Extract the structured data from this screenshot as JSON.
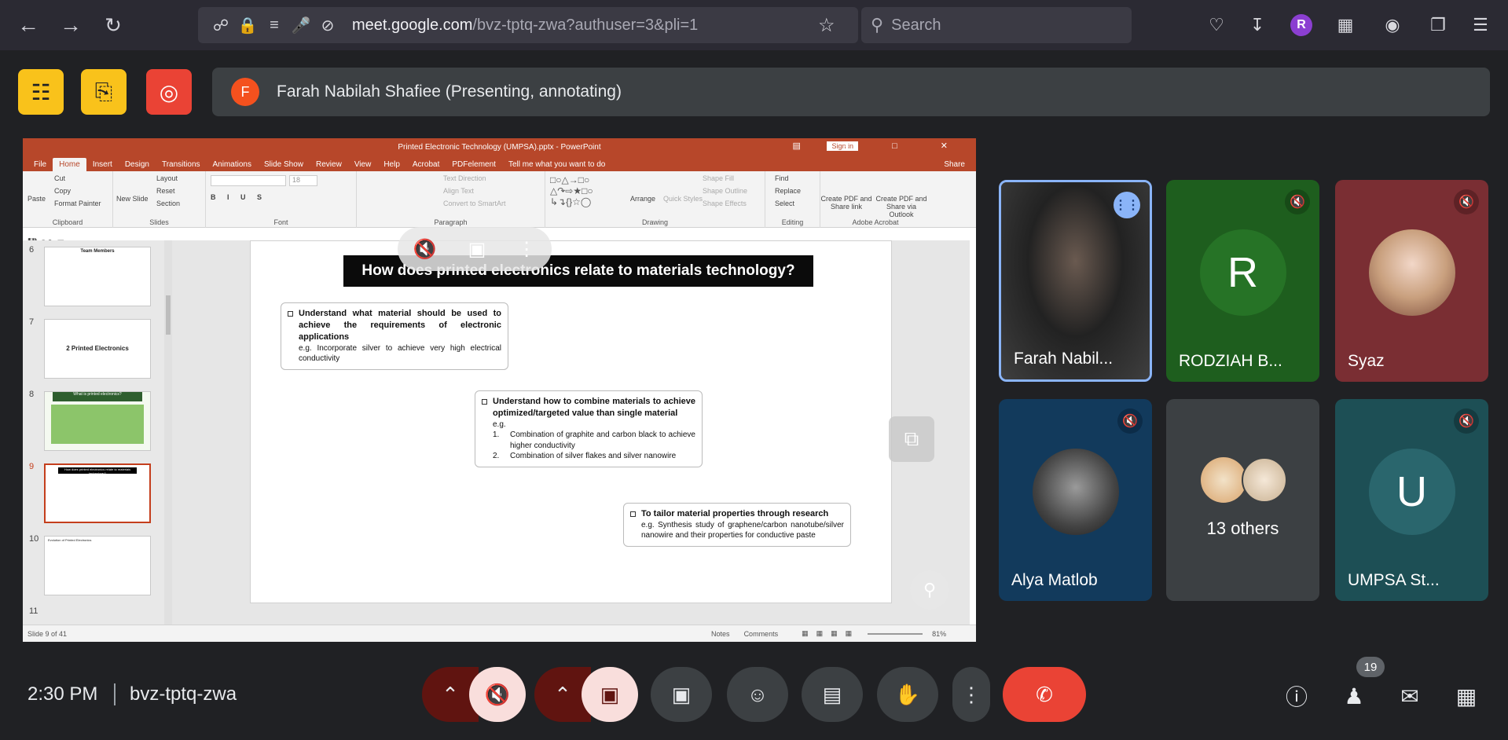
{
  "browser": {
    "url_domain": "meet.google.com",
    "url_path": "/bvz-tptq-zwa?authuser=3&pli=1",
    "search_placeholder": "Search",
    "profile_initial": "R"
  },
  "meet": {
    "presenter_initial": "F",
    "presenter_text": "Farah Nabilah Shafiee (Presenting, annotating)",
    "time": "2:30 PM",
    "meeting_code": "bvz-tptq-zwa",
    "people_count": "19"
  },
  "ppt": {
    "window_title": "Printed Electronic Technology (UMPSA).pptx - PowerPoint",
    "sign_in": "Sign in",
    "tabs": [
      "File",
      "Home",
      "Insert",
      "Design",
      "Transitions",
      "Animations",
      "Slide Show",
      "Review",
      "View",
      "Help",
      "Acrobat",
      "PDFelement",
      "Tell me what you want to do"
    ],
    "share": "Share",
    "ribbon": {
      "clipboard": "Clipboard",
      "paste": "Paste",
      "cut": "Cut",
      "copy": "Copy",
      "format_painter": "Format Painter",
      "slides": "Slides",
      "new_slide": "New Slide",
      "layout": "Layout",
      "reset": "Reset",
      "section": "Section",
      "font": "Font",
      "font_size": "18",
      "paragraph": "Paragraph",
      "text_direction": "Text Direction",
      "align_text": "Align Text",
      "convert_smartart": "Convert to SmartArt",
      "drawing": "Drawing",
      "arrange": "Arrange",
      "quick_styles": "Quick Styles",
      "shape_fill": "Shape Fill",
      "shape_outline": "Shape Outline",
      "shape_effects": "Shape Effects",
      "editing": "Editing",
      "find": "Find",
      "replace": "Replace",
      "select": "Select",
      "adobe": "Adobe Acrobat",
      "create_pdf_share": "Create PDF and Share link",
      "create_pdf_outlook": "Create PDF and Share via Outlook"
    },
    "thumbnails": [
      {
        "num": "6",
        "title": "Team Members"
      },
      {
        "num": "7",
        "title": "2 Printed Electronics"
      },
      {
        "num": "8",
        "title": "What is printed electronics?"
      },
      {
        "num": "9",
        "title": "How does printed electronics relate to materials technology?"
      },
      {
        "num": "10",
        "title": "Evolution of Printed Electronics"
      },
      {
        "num": "11",
        "title": ""
      }
    ],
    "slide": {
      "title": "How does printed electronics relate to materials technology?",
      "box1_head": "Understand what material should be used to achieve the requirements of electronic applications",
      "box1_sub": "e.g. Incorporate silver to achieve very high electrical conductivity",
      "box2_head": "Understand how to combine materials to achieve optimized/targeted value than single material",
      "box2_eg": "e.g.",
      "box2_item1_num": "1.",
      "box2_item1": "Combination of graphite and carbon black to achieve higher conductivity",
      "box2_item2_num": "2.",
      "box2_item2": "Combination of silver flakes and silver nanowire",
      "box3_head": "To tailor material properties through research",
      "box3_sub": "e.g. Synthesis study of graphene/carbon nanotube/silver nanowire and their properties for conductive paste"
    },
    "status": {
      "slide_of": "Slide 9 of 41",
      "notes": "Notes",
      "comments": "Comments",
      "zoom": "81%"
    }
  },
  "tiles": [
    {
      "name": "Farah Nabil...",
      "type": "video",
      "color": "#3a3a3a"
    },
    {
      "name": "RODZIAH B...",
      "letter": "R",
      "color": "#1e5e1e"
    },
    {
      "name": "Syaz",
      "color": "#7a2e33"
    },
    {
      "name": "Alya Matlob",
      "color": "#123a5c"
    },
    {
      "name": "13 others",
      "color": "#3c4043"
    },
    {
      "name": "UMPSA St...",
      "letter": "U",
      "color": "#1d4f55"
    }
  ]
}
